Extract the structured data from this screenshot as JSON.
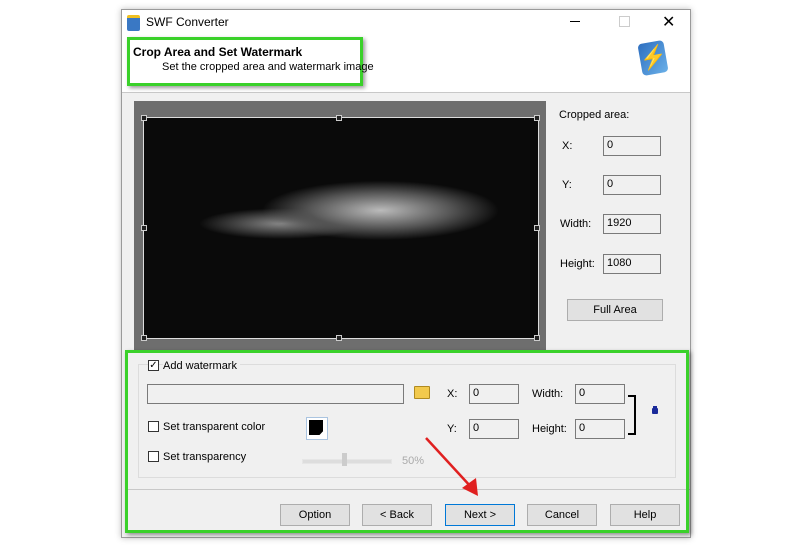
{
  "window": {
    "title": "SWF Converter"
  },
  "header": {
    "title": "Crop Area and Set Watermark",
    "subtitle": "Set the cropped area and watermark image"
  },
  "crop": {
    "label": "Cropped area:",
    "x_label": "X:",
    "x": "0",
    "y_label": "Y:",
    "y": "0",
    "width_label": "Width:",
    "width": "1920",
    "height_label": "Height:",
    "height": "1080",
    "full_area": "Full Area"
  },
  "watermark": {
    "add_label": "Add watermark",
    "add_checked": true,
    "path": "",
    "x_label": "X:",
    "x": "0",
    "y_label": "Y:",
    "y": "0",
    "width_label": "Width:",
    "width": "0",
    "height_label": "Height:",
    "height": "0",
    "transparent_color_label": "Set transparent color",
    "transparency_label": "Set transparency",
    "transparency_value": "50%",
    "transparency_fraction": 0.5
  },
  "buttons": {
    "option": "Option",
    "back": "< Back",
    "next": "Next >",
    "cancel": "Cancel",
    "help": "Help"
  },
  "colors": {
    "highlight": "#3ad12a",
    "arrow": "#e02020"
  }
}
